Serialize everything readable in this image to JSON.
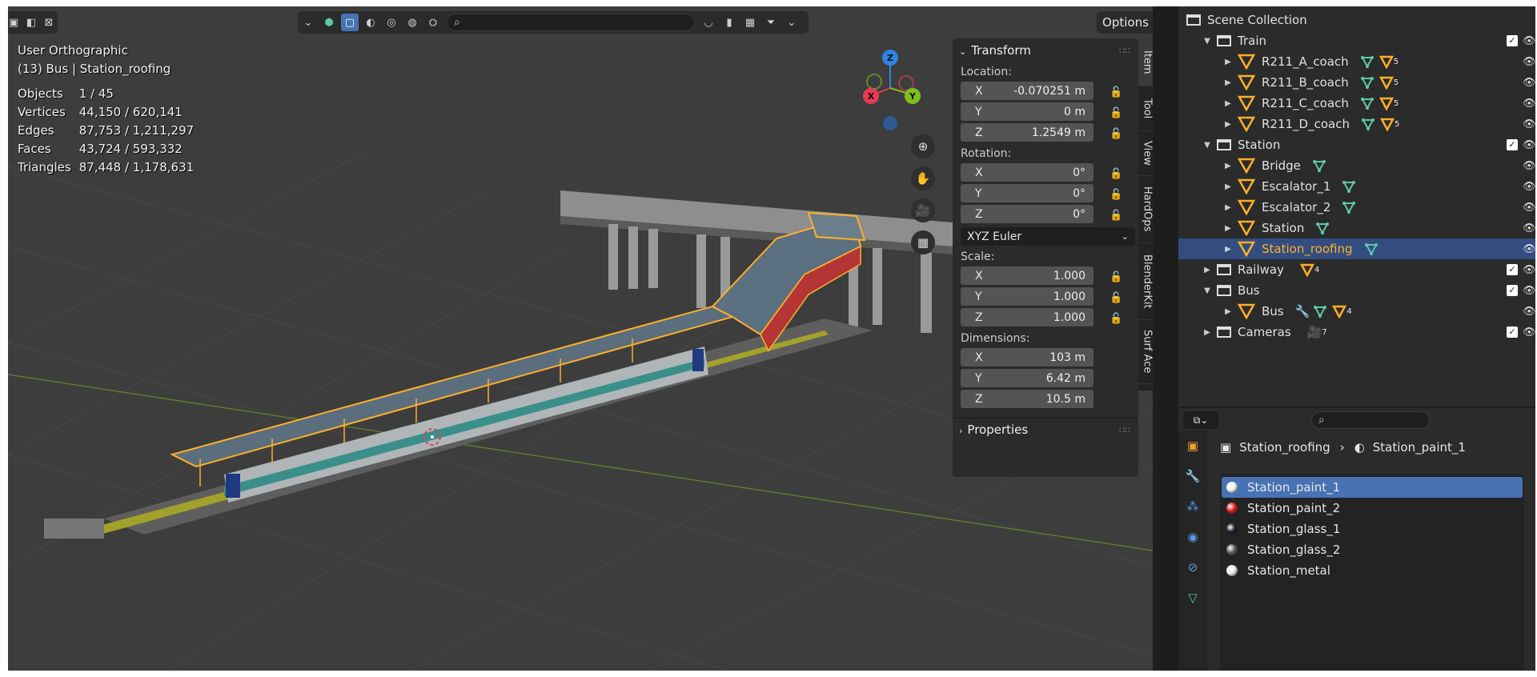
{
  "viewport": {
    "header": {
      "search_placeholder": ""
    },
    "options_label": "Options",
    "view_name": "User Orthographic",
    "object_info": "(13) Bus | Station_roofing",
    "stats": [
      {
        "label": "Objects",
        "value": "1 / 45"
      },
      {
        "label": "Vertices",
        "value": "44,150 / 620,141"
      },
      {
        "label": "Edges",
        "value": "87,753 / 1,211,297"
      },
      {
        "label": "Faces",
        "value": "43,724 / 593,332"
      },
      {
        "label": "Triangles",
        "value": "87,448 / 1,178,631"
      }
    ],
    "gizmo": {
      "x": "X",
      "y": "Y",
      "z": "Z"
    },
    "colors": {
      "accent": "#4772b3",
      "selection": "#ffaf29",
      "x_axis": "#e63c57",
      "y_axis": "#7cbf1f",
      "z_axis": "#2f83e3"
    }
  },
  "transform_panel": {
    "title": "Transform",
    "location_label": "Location:",
    "location": [
      {
        "axis": "X",
        "value": "-0.070251 m"
      },
      {
        "axis": "Y",
        "value": "0 m"
      },
      {
        "axis": "Z",
        "value": "1.2549 m"
      }
    ],
    "rotation_label": "Rotation:",
    "rotation": [
      {
        "axis": "X",
        "value": "0°"
      },
      {
        "axis": "Y",
        "value": "0°"
      },
      {
        "axis": "Z",
        "value": "0°"
      }
    ],
    "rotation_mode": "XYZ Euler",
    "scale_label": "Scale:",
    "scale": [
      {
        "axis": "X",
        "value": "1.000"
      },
      {
        "axis": "Y",
        "value": "1.000"
      },
      {
        "axis": "Z",
        "value": "1.000"
      }
    ],
    "dimensions_label": "Dimensions:",
    "dimensions": [
      {
        "axis": "X",
        "value": "103 m"
      },
      {
        "axis": "Y",
        "value": "6.42 m"
      },
      {
        "axis": "Z",
        "value": "10.5 m"
      }
    ],
    "properties_title": "Properties"
  },
  "side_tabs": [
    "Item",
    "Tool",
    "View",
    "HardOps",
    "BlenderKit",
    "Surf Ace"
  ],
  "outliner": {
    "root": "Scene Collection",
    "rows": [
      {
        "name": "Train",
        "kind": "collection",
        "level": 1,
        "open": true
      },
      {
        "name": "R211_A_coach",
        "kind": "object",
        "level": 2,
        "extra": "5"
      },
      {
        "name": "R211_B_coach",
        "kind": "object",
        "level": 2,
        "extra": "5"
      },
      {
        "name": "R211_C_coach",
        "kind": "object",
        "level": 2,
        "extra": "5"
      },
      {
        "name": "R211_D_coach",
        "kind": "object",
        "level": 2,
        "extra": "5"
      },
      {
        "name": "Station",
        "kind": "collection",
        "level": 1,
        "open": true
      },
      {
        "name": "Bridge",
        "kind": "object",
        "level": 2,
        "extra": ""
      },
      {
        "name": "Escalator_1",
        "kind": "object",
        "level": 2,
        "extra": ""
      },
      {
        "name": "Escalator_2",
        "kind": "object",
        "level": 2,
        "extra": ""
      },
      {
        "name": "Station",
        "kind": "object",
        "level": 2,
        "extra": ""
      },
      {
        "name": "Station_roofing",
        "kind": "object",
        "level": 2,
        "extra": "",
        "selected": true
      },
      {
        "name": "Railway",
        "kind": "collection",
        "level": 1,
        "open": false,
        "extra": "4"
      },
      {
        "name": "Bus",
        "kind": "collection",
        "level": 1,
        "open": true
      },
      {
        "name": "Bus",
        "kind": "object",
        "level": 2,
        "extra": "4"
      },
      {
        "name": "Cameras",
        "kind": "collection",
        "level": 1,
        "open": false,
        "extra": "7"
      }
    ]
  },
  "properties": {
    "breadcrumb_object": "Station_roofing",
    "breadcrumb_material": "Station_paint_1",
    "materials": [
      {
        "name": "Station_paint_1",
        "color": "#f2f2f2",
        "selected": true
      },
      {
        "name": "Station_paint_2",
        "color": "#e01b1b"
      },
      {
        "name": "Station_glass_1",
        "color": "#1a1f26"
      },
      {
        "name": "Station_glass_2",
        "color": "#5b5b5b"
      },
      {
        "name": "Station_metal",
        "color": "#e8e8e8"
      }
    ]
  }
}
